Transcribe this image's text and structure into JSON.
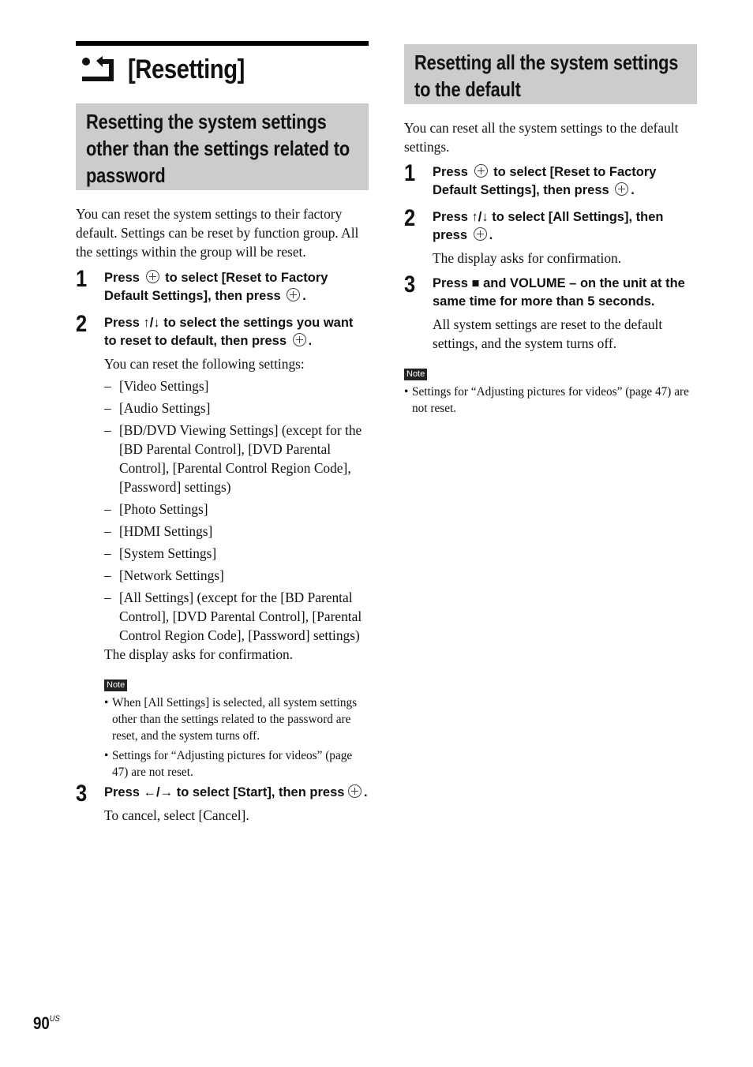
{
  "chapter": {
    "icon": "reset-icon",
    "title": "[Resetting]"
  },
  "left": {
    "section_title": "Resetting the system settings other than the settings related to password",
    "intro": "You can reset the system settings to their factory default. Settings can be reset by function group. All the settings within the group will be reset.",
    "steps": [
      {
        "number": "1",
        "head_a": "Press",
        "head_b": "to select [Reset to Factory Default Settings], then press",
        "head_c": "."
      },
      {
        "number": "2",
        "head_a": "Press ↑/↓ to select the settings you want to reset to default, then press",
        "head_c": ".",
        "body": "You can reset the following settings:",
        "items": [
          "[Video Settings]",
          "[Audio Settings]",
          "[BD/DVD Viewing Settings] (except for the [BD Parental Control], [DVD Parental Control], [Parental Control Region Code], [Password] settings)",
          "[Photo Settings]",
          "[HDMI Settings]",
          "[System Settings]",
          "[Network Settings]",
          "[All Settings] (except for the [BD Parental Control], [DVD Parental Control], [Parental Control Region Code], [Password] settings)"
        ],
        "after": "The display asks for confirmation.",
        "note_label": "Note",
        "notes": [
          "When [All Settings] is selected, all system settings other than the settings related to the password are reset, and the system turns off.",
          "Settings for “Adjusting pictures for videos” (page 47) are not reset."
        ]
      },
      {
        "number": "3",
        "head_a": "Press ←/→ to select [Start], then press",
        "head_c": ".",
        "body": "To cancel, select [Cancel]."
      }
    ]
  },
  "right": {
    "section_title": "Resetting all the system settings to the default",
    "intro": "You can reset all the system settings to the default settings.",
    "steps": [
      {
        "number": "1",
        "head_a": "Press",
        "head_b": "to select [Reset to Factory Default Settings], then press",
        "head_c": "."
      },
      {
        "number": "2",
        "head_a": "Press ↑/↓ to select [All Settings], then press",
        "head_c": ".",
        "body": "The display asks for confirmation."
      },
      {
        "number": "3",
        "head_a": "Press ■ and VOLUME – on the unit at the same time for more than 5 seconds.",
        "body": "All system settings are reset to the default settings, and the system turns off."
      }
    ],
    "note_label": "Note",
    "notes": [
      "Settings for “Adjusting pictures for videos” (page 47) are not reset."
    ]
  },
  "footer": {
    "page_number": "90",
    "region": "US"
  }
}
